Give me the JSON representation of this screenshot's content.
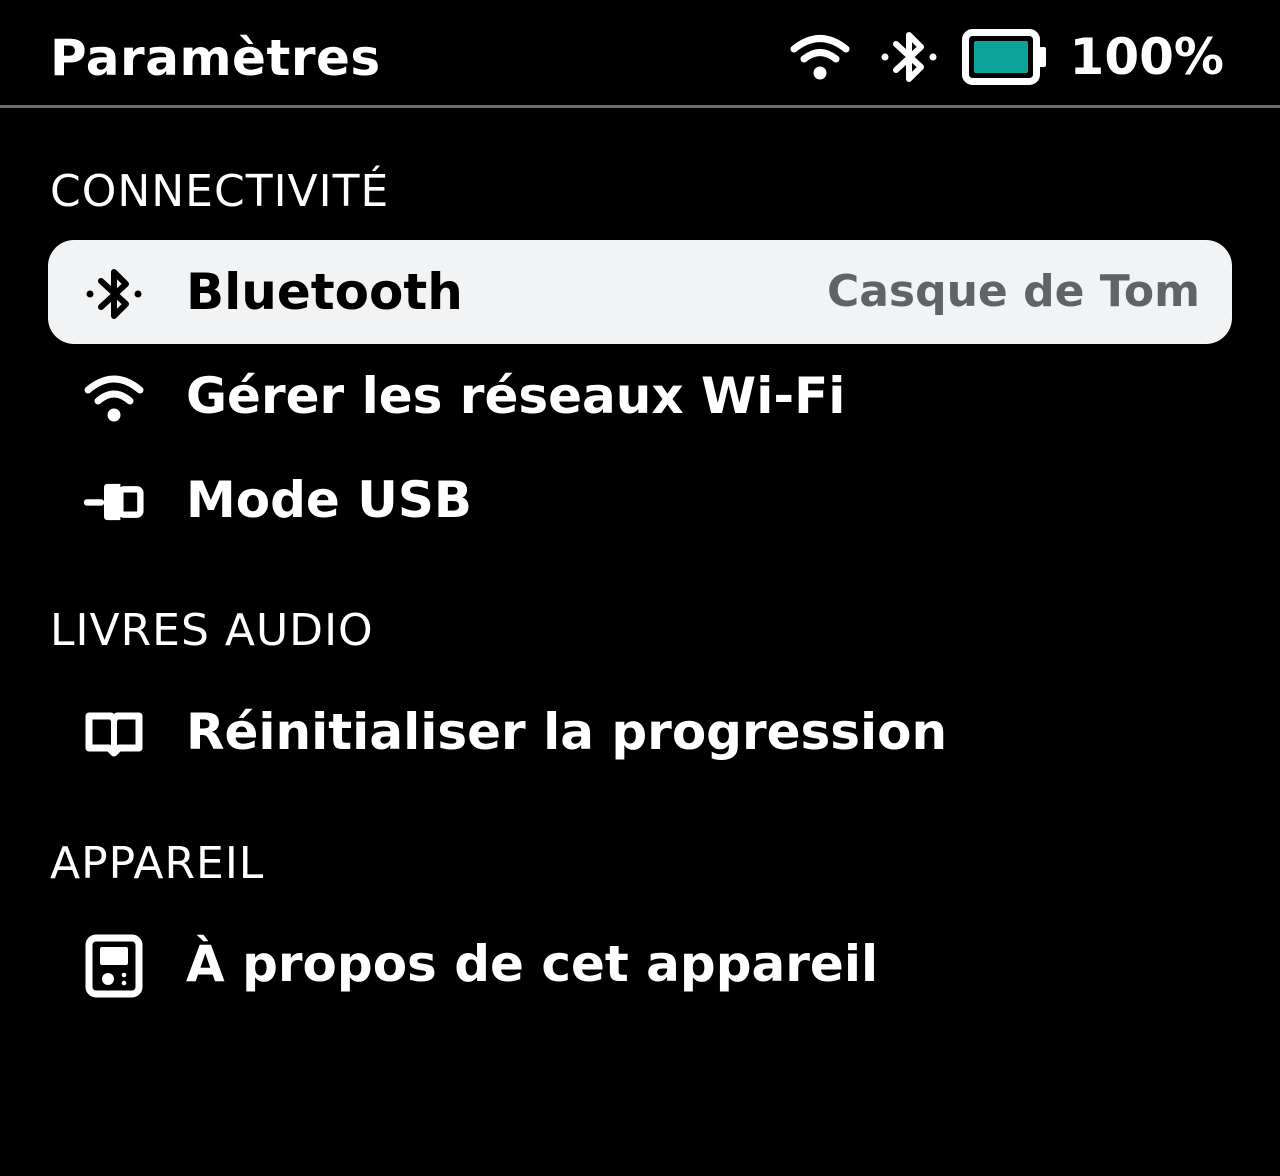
{
  "status_bar": {
    "title": "Paramètres",
    "battery_percent": "100%",
    "battery_level": 1.0,
    "battery_color": "#0ba39a",
    "icons": [
      "wifi-icon",
      "bluetooth-icon",
      "battery-icon"
    ]
  },
  "sections": {
    "connectivity": {
      "header": "CONNECTIVITÉ",
      "items": [
        {
          "label": "Bluetooth",
          "value": "Casque de Tom",
          "icon": "bluetooth-icon",
          "selected": true
        },
        {
          "label": "Gérer les réseaux Wi-Fi",
          "icon": "wifi-icon"
        },
        {
          "label": "Mode USB",
          "icon": "usb-plug-icon"
        }
      ]
    },
    "audiobooks": {
      "header": "LIVRES AUDIO",
      "items": [
        {
          "label": "Réinitialiser la progression",
          "icon": "open-book-icon"
        }
      ]
    },
    "device": {
      "header": "APPAREIL",
      "items": [
        {
          "label": "À propos de cet appareil",
          "icon": "device-icon"
        }
      ]
    }
  },
  "colors": {
    "background": "#000000",
    "text": "#ffffff",
    "selected_background": "#f2f3f4",
    "selected_text": "#000000",
    "secondary_text": "#5f6566",
    "divider": "#6e6e6e"
  }
}
